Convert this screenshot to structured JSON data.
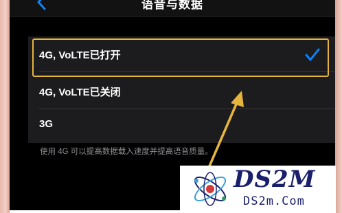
{
  "nav": {
    "title": "语音与数据"
  },
  "options": [
    {
      "label": "4G, VoLTE已打开",
      "selected": true
    },
    {
      "label": "4G, VoLTE已关闭",
      "selected": false
    },
    {
      "label": "3G",
      "selected": false
    }
  ],
  "footer_note": "使用 4G 可以提高数据载入速度并提高语音质量。",
  "watermark": {
    "brand": "DS2M",
    "domain": "DS2m.Com"
  },
  "colors": {
    "highlight": "#e6b53c",
    "check": "#0a84ff",
    "background": "#000000",
    "cell": "#1c1c1e"
  }
}
